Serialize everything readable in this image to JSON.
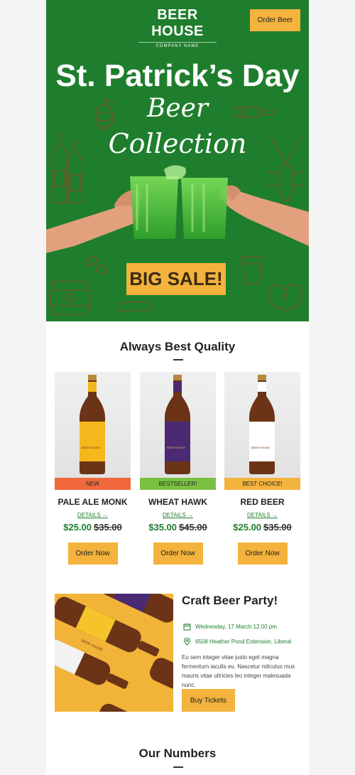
{
  "header": {
    "logo_title": "BEER HOUSE",
    "logo_subtitle": "COMPANY NAME",
    "order_button": "Order Beer"
  },
  "hero": {
    "title": "St. Patrick’s  Day",
    "script_line1": "Beer",
    "script_line2": "Collection",
    "sale_label": "BIG SALE!",
    "background_color": "#1f7e2d",
    "accent_color": "#f3b33d"
  },
  "quality": {
    "title": "Always Best Quality",
    "products": [
      {
        "badge": "NEW",
        "badge_color": "#f0683c",
        "label_color": "#f5b81c",
        "name": "PALE ALE MONK",
        "details": "DETAILS →",
        "price": "$25.00",
        "old_price": "$35.00",
        "button": "Order Now",
        "bottle_label": "BEER HOUSE"
      },
      {
        "badge": "BESTSELLER!",
        "badge_color": "#7ac142",
        "label_color": "#4a2a73",
        "name": "WHEAT HAWK",
        "details": "DETAILS →",
        "price": "$35.00",
        "old_price": "$45.00",
        "button": "Order Now",
        "bottle_label": "BEER HOUSE"
      },
      {
        "badge": "BEST CHOICE!",
        "badge_color": "#f3b33d",
        "label_color": "#ffffff",
        "name": "RED BEER",
        "details": "DETAILS →",
        "price": "$25.00",
        "old_price": "$35.00",
        "button": "Order Now",
        "bottle_label": "BEER HOUSE"
      }
    ]
  },
  "event": {
    "title": "Craft Beer Party!",
    "date": "Wednesday, 17 March 12.00 pm",
    "address": "6508 Heather Pond Extension, Liberal",
    "description": "Eu sem integer vitae justo eget magna fermentum iaculis eu. Nascetur ridiculus mus mauris vitae ultricies leo integer malesuada nunc.",
    "button": "Buy Tickets",
    "bottle_label": "BEER HOUSE"
  },
  "numbers": {
    "title": "Our Numbers"
  }
}
